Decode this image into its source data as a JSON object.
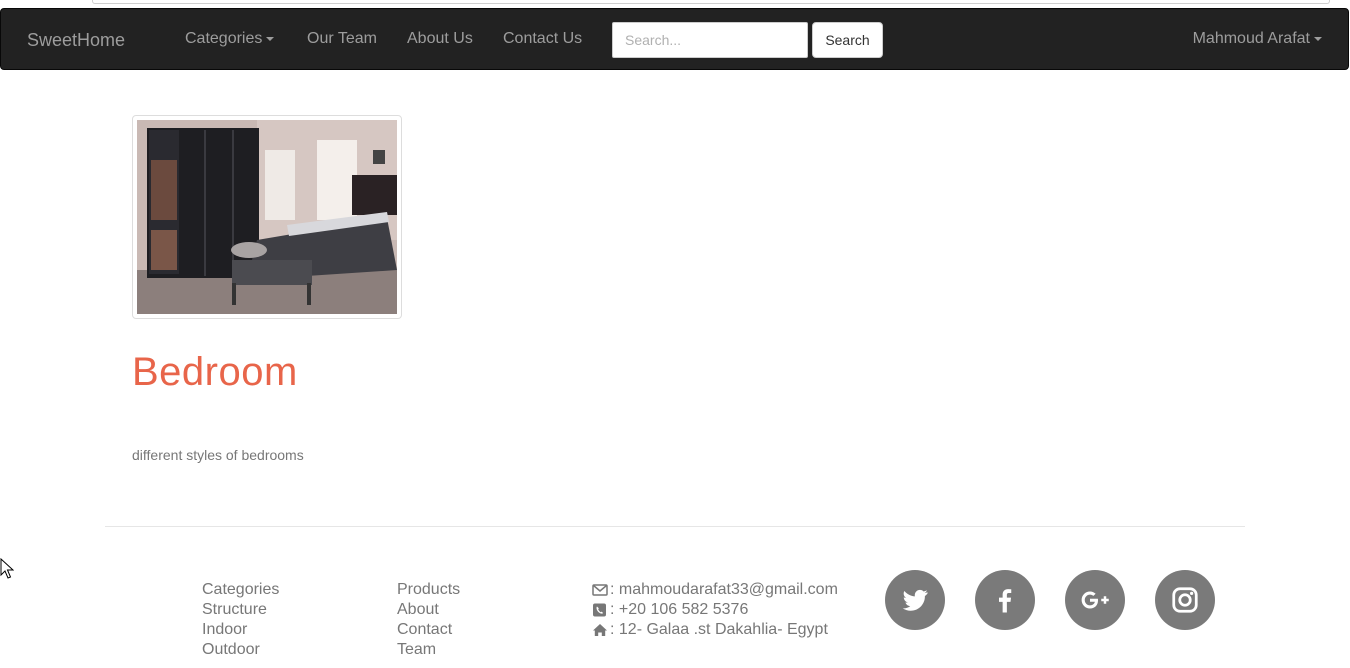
{
  "navbar": {
    "brand": "SweetHome",
    "categories_label": "Categories",
    "links": [
      "Our Team",
      "About Us",
      "Contact Us"
    ],
    "search_placeholder": "Search...",
    "search_button": "Search",
    "user_name": "Mahmoud Arafat"
  },
  "category": {
    "image_alt": "Bedroom",
    "title": "Bedroom",
    "description": "different styles of bedrooms"
  },
  "footer": {
    "col1": [
      "Categories",
      "Structure",
      "Indoor",
      "Outdoor"
    ],
    "col2": [
      "Products",
      "About",
      "Contact",
      "Team"
    ],
    "contact": {
      "email": ": mahmoudarafat33@gmail.com",
      "phone": ": +20 106 582 5376",
      "address": ": 12- Galaa .st Dakahlia- Egypt"
    },
    "social_icons": [
      "twitter-icon",
      "facebook-icon",
      "google-plus-icon",
      "instagram-icon"
    ]
  },
  "colors": {
    "navbar_bg": "#222222",
    "nav_text": "#9d9d9d",
    "title_accent": "#e8654a",
    "social_bg": "#7a7a7a"
  }
}
